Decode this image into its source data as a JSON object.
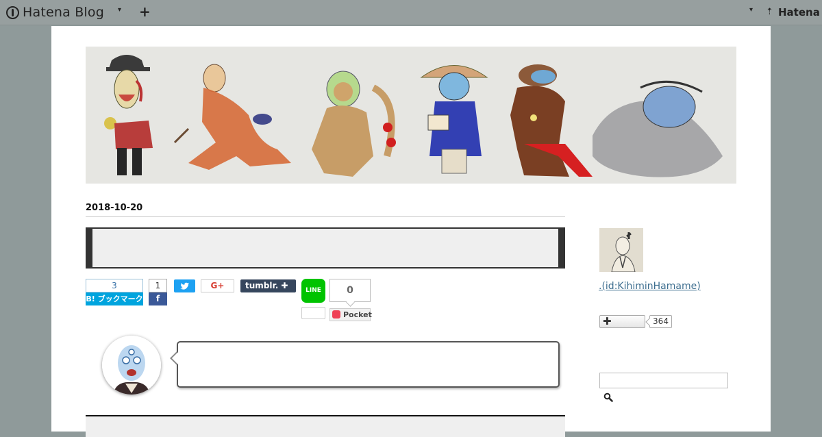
{
  "topbar": {
    "logo_text": "Hatena Blog",
    "caret": "▾",
    "plus": "+",
    "right_caret": "▾",
    "hatena_mark": "⇡",
    "hatena_text": "Hatena"
  },
  "entry": {
    "date": "2018-10-20",
    "title": ""
  },
  "share": {
    "hatebu_count": "3",
    "hatebu_label": "B! ブックマーク",
    "facebook_count": "1",
    "facebook_icon": "f",
    "googleplus_label": "G+",
    "tumblr_label": "tumblr. ✚",
    "line_label": "LINE",
    "line_count": "",
    "pocket_count": "0",
    "pocket_label": "Pocket"
  },
  "sidebar": {
    "profile_id": ".(id:KihiminHamame)",
    "follow_plus": "✚",
    "follow_count": "364",
    "search_placeholder": ""
  },
  "colors": {
    "topbar": "#979f9f",
    "hatebu": "#00a4de",
    "facebook": "#3b5998",
    "twitter": "#1da1f2",
    "tumblr": "#36465d",
    "line": "#00c300",
    "pocket": "#ef4056",
    "link": "#3d6e8f"
  }
}
